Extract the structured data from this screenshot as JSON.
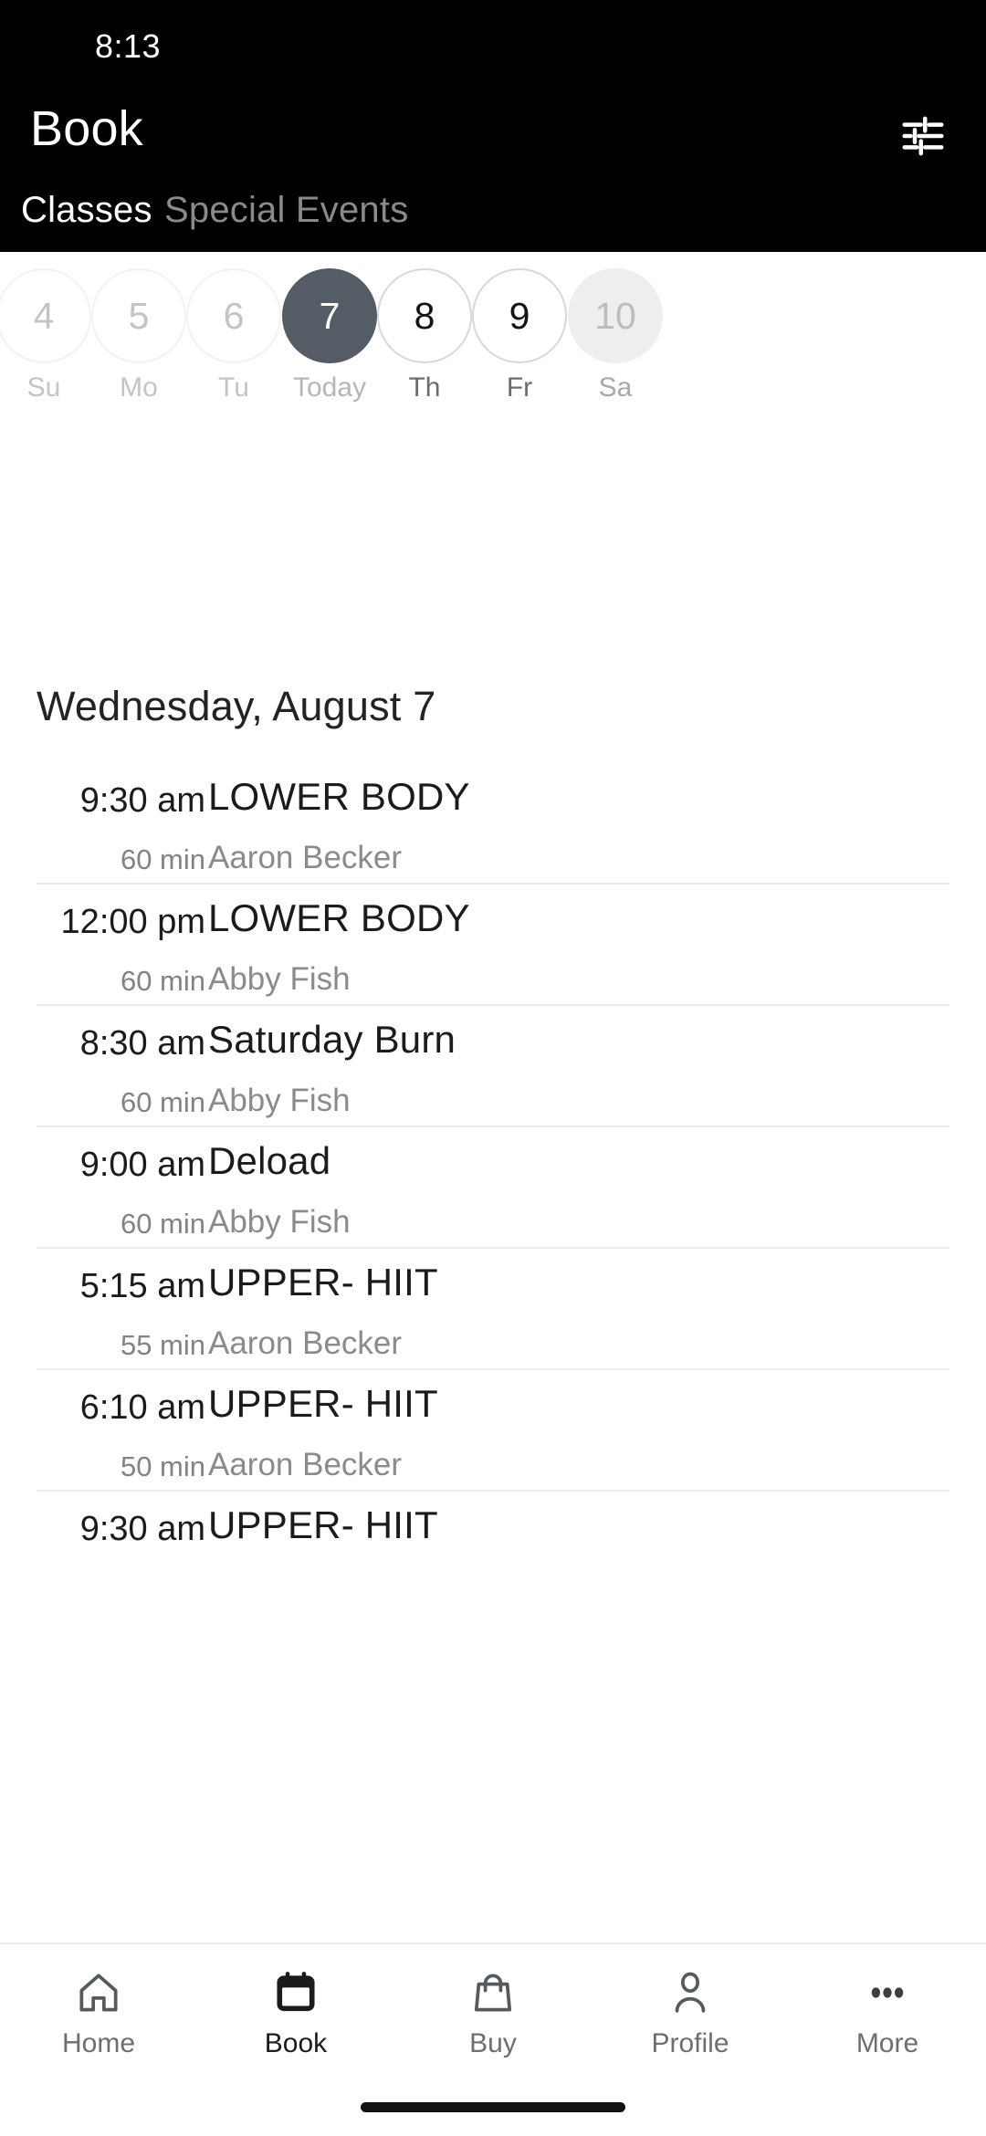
{
  "status_bar": {
    "time": "8:13"
  },
  "app_bar": {
    "title": "Book",
    "filter_icon": "tune-icon"
  },
  "tabs": [
    {
      "label": "Classes",
      "active": true
    },
    {
      "label": "Special Events",
      "active": false
    }
  ],
  "date_strip": [
    {
      "day": "4",
      "weekday": "Su",
      "state": "past"
    },
    {
      "day": "5",
      "weekday": "Mo",
      "state": "past"
    },
    {
      "day": "6",
      "weekday": "Tu",
      "state": "past"
    },
    {
      "day": "7",
      "weekday": "Today",
      "state": "selected"
    },
    {
      "day": "8",
      "weekday": "Th",
      "state": "open"
    },
    {
      "day": "9",
      "weekday": "Fr",
      "state": "open"
    },
    {
      "day": "10",
      "weekday": "Sa",
      "state": "greyfill"
    }
  ],
  "date_heading": "Wednesday, August 7",
  "classes": [
    {
      "time": "9:30 am",
      "duration": "60 min",
      "name": "LOWER BODY",
      "coach": "Aaron Becker"
    },
    {
      "time": "12:00 pm",
      "duration": "60 min",
      "name": "LOWER BODY",
      "coach": "Abby Fish"
    },
    {
      "time": "8:30 am",
      "duration": "60 min",
      "name": "Saturday Burn",
      "coach": "Abby Fish"
    },
    {
      "time": "9:00 am",
      "duration": "60 min",
      "name": "Deload",
      "coach": "Abby Fish"
    },
    {
      "time": "5:15 am",
      "duration": "55 min",
      "name": "UPPER- HIIT",
      "coach": "Aaron Becker"
    },
    {
      "time": "6:10 am",
      "duration": "50 min",
      "name": "UPPER- HIIT",
      "coach": "Aaron Becker"
    },
    {
      "time": "9:30 am",
      "duration": "",
      "name": "UPPER- HIIT",
      "coach": ""
    }
  ],
  "bottom_nav": [
    {
      "label": "Home",
      "icon": "home-icon",
      "active": false
    },
    {
      "label": "Book",
      "icon": "calendar-icon",
      "active": true
    },
    {
      "label": "Buy",
      "icon": "bag-icon",
      "active": false
    },
    {
      "label": "Profile",
      "icon": "person-icon",
      "active": false
    },
    {
      "label": "More",
      "icon": "dots-icon",
      "active": false
    }
  ],
  "colors": {
    "header_background": "#000000",
    "selected_day": "#555c66",
    "greyfill_day": "#eeeeee",
    "text_primary": "#1b1b1b",
    "text_secondary": "#8b8b8b",
    "divider": "#ececec"
  }
}
